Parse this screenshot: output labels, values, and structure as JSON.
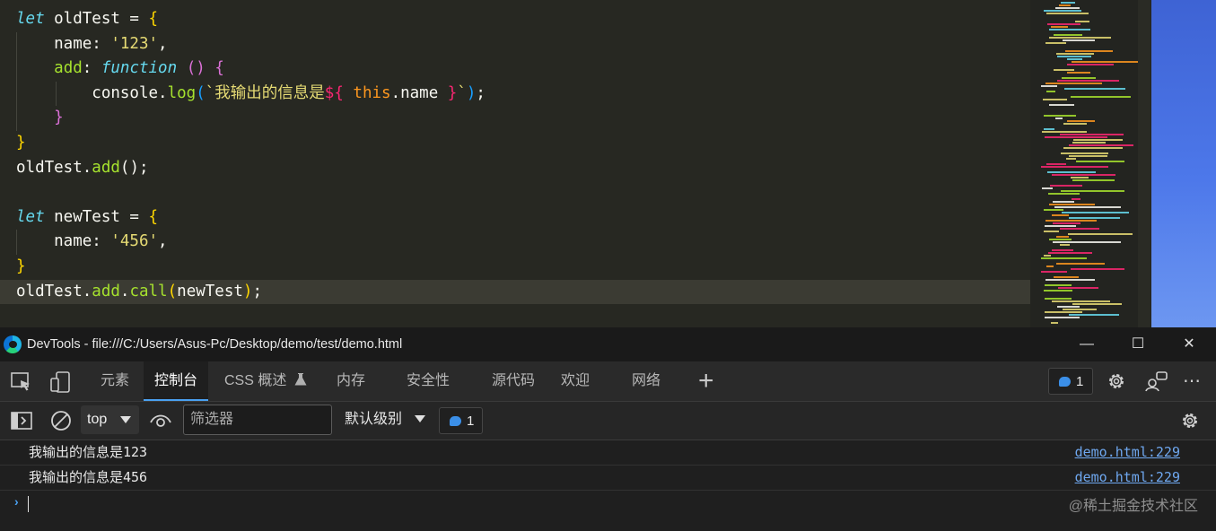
{
  "editor": {
    "lines": [
      {
        "tokens": [
          {
            "t": "let",
            "c": "t-kw"
          },
          {
            "t": " oldTest = "
          },
          {
            "t": "{",
            "c": "t-b1"
          }
        ]
      },
      {
        "indent": 1,
        "tokens": [
          {
            "t": "    name: "
          },
          {
            "t": "'123'",
            "c": "t-str"
          },
          {
            "t": ","
          }
        ]
      },
      {
        "indent": 1,
        "tokens": [
          {
            "t": "    "
          },
          {
            "t": "add",
            "c": "t-fn"
          },
          {
            "t": ": "
          },
          {
            "t": "function",
            "c": "t-kw"
          },
          {
            "t": " "
          },
          {
            "t": "()",
            "c": "t-b2"
          },
          {
            "t": " "
          },
          {
            "t": "{",
            "c": "t-b2"
          }
        ]
      },
      {
        "indent": 2,
        "tokens": [
          {
            "t": "        console."
          },
          {
            "t": "log",
            "c": "t-fn"
          },
          {
            "t": "(",
            "c": "t-b3"
          },
          {
            "t": "`我输出的信息是",
            "c": "t-str"
          },
          {
            "t": "${",
            "c": "t-tpl"
          },
          {
            "t": " "
          },
          {
            "t": "this",
            "c": "t-this"
          },
          {
            "t": ".name "
          },
          {
            "t": "}",
            "c": "t-tpl"
          },
          {
            "t": "`",
            "c": "t-str"
          },
          {
            "t": ")",
            "c": "t-b3"
          },
          {
            "t": ";"
          }
        ]
      },
      {
        "indent": 1,
        "tokens": [
          {
            "t": "    "
          },
          {
            "t": "}",
            "c": "t-b2"
          }
        ]
      },
      {
        "tokens": [
          {
            "t": "}",
            "c": "t-b1"
          }
        ]
      },
      {
        "tokens": [
          {
            "t": "oldTest."
          },
          {
            "t": "add",
            "c": "t-fn"
          },
          {
            "t": "();"
          }
        ]
      },
      {
        "tokens": [
          {
            "t": " "
          }
        ]
      },
      {
        "tokens": [
          {
            "t": "let",
            "c": "t-kw"
          },
          {
            "t": " newTest = "
          },
          {
            "t": "{",
            "c": "t-b1"
          }
        ]
      },
      {
        "indent": 1,
        "tokens": [
          {
            "t": "    name: "
          },
          {
            "t": "'456'",
            "c": "t-str"
          },
          {
            "t": ","
          }
        ]
      },
      {
        "tokens": [
          {
            "t": "}",
            "c": "t-b1"
          }
        ]
      },
      {
        "current": true,
        "tokens": [
          {
            "t": "oldTest."
          },
          {
            "t": "add",
            "c": "t-fn"
          },
          {
            "t": "."
          },
          {
            "t": "call",
            "c": "t-fn"
          },
          {
            "t": "(",
            "c": "t-b1"
          },
          {
            "t": "newTest"
          },
          {
            "t": ")",
            "c": "t-b1"
          },
          {
            "t": ";"
          }
        ]
      }
    ]
  },
  "window": {
    "title": "DevTools - file:///C:/Users/Asus-Pc/Desktop/demo/test/demo.html",
    "minimize": "—",
    "maximize": "☐",
    "close": "✕"
  },
  "tabs": {
    "elements": "元素",
    "console": "控制台",
    "css_overview": "CSS 概述",
    "memory": "内存",
    "security": "安全性",
    "sources": "源代码",
    "welcome": "欢迎",
    "network": "网络",
    "add": "+",
    "issues_count": "1",
    "more": "⋯"
  },
  "filterbar": {
    "context": "top",
    "filter_placeholder": "筛选器",
    "level": "默认级别",
    "issues_count": "1"
  },
  "console": {
    "messages": [
      {
        "text": "我输出的信息是123",
        "source": "demo.html:229"
      },
      {
        "text": "我输出的信息是456",
        "source": "demo.html:229"
      }
    ],
    "prompt": "›"
  },
  "watermark": "@稀土掘金技术社区",
  "colors": {
    "editor_bg": "#272822",
    "devtools_bg": "#1f1f1f",
    "accent": "#4aa0f0",
    "link": "#6fa8f0"
  }
}
